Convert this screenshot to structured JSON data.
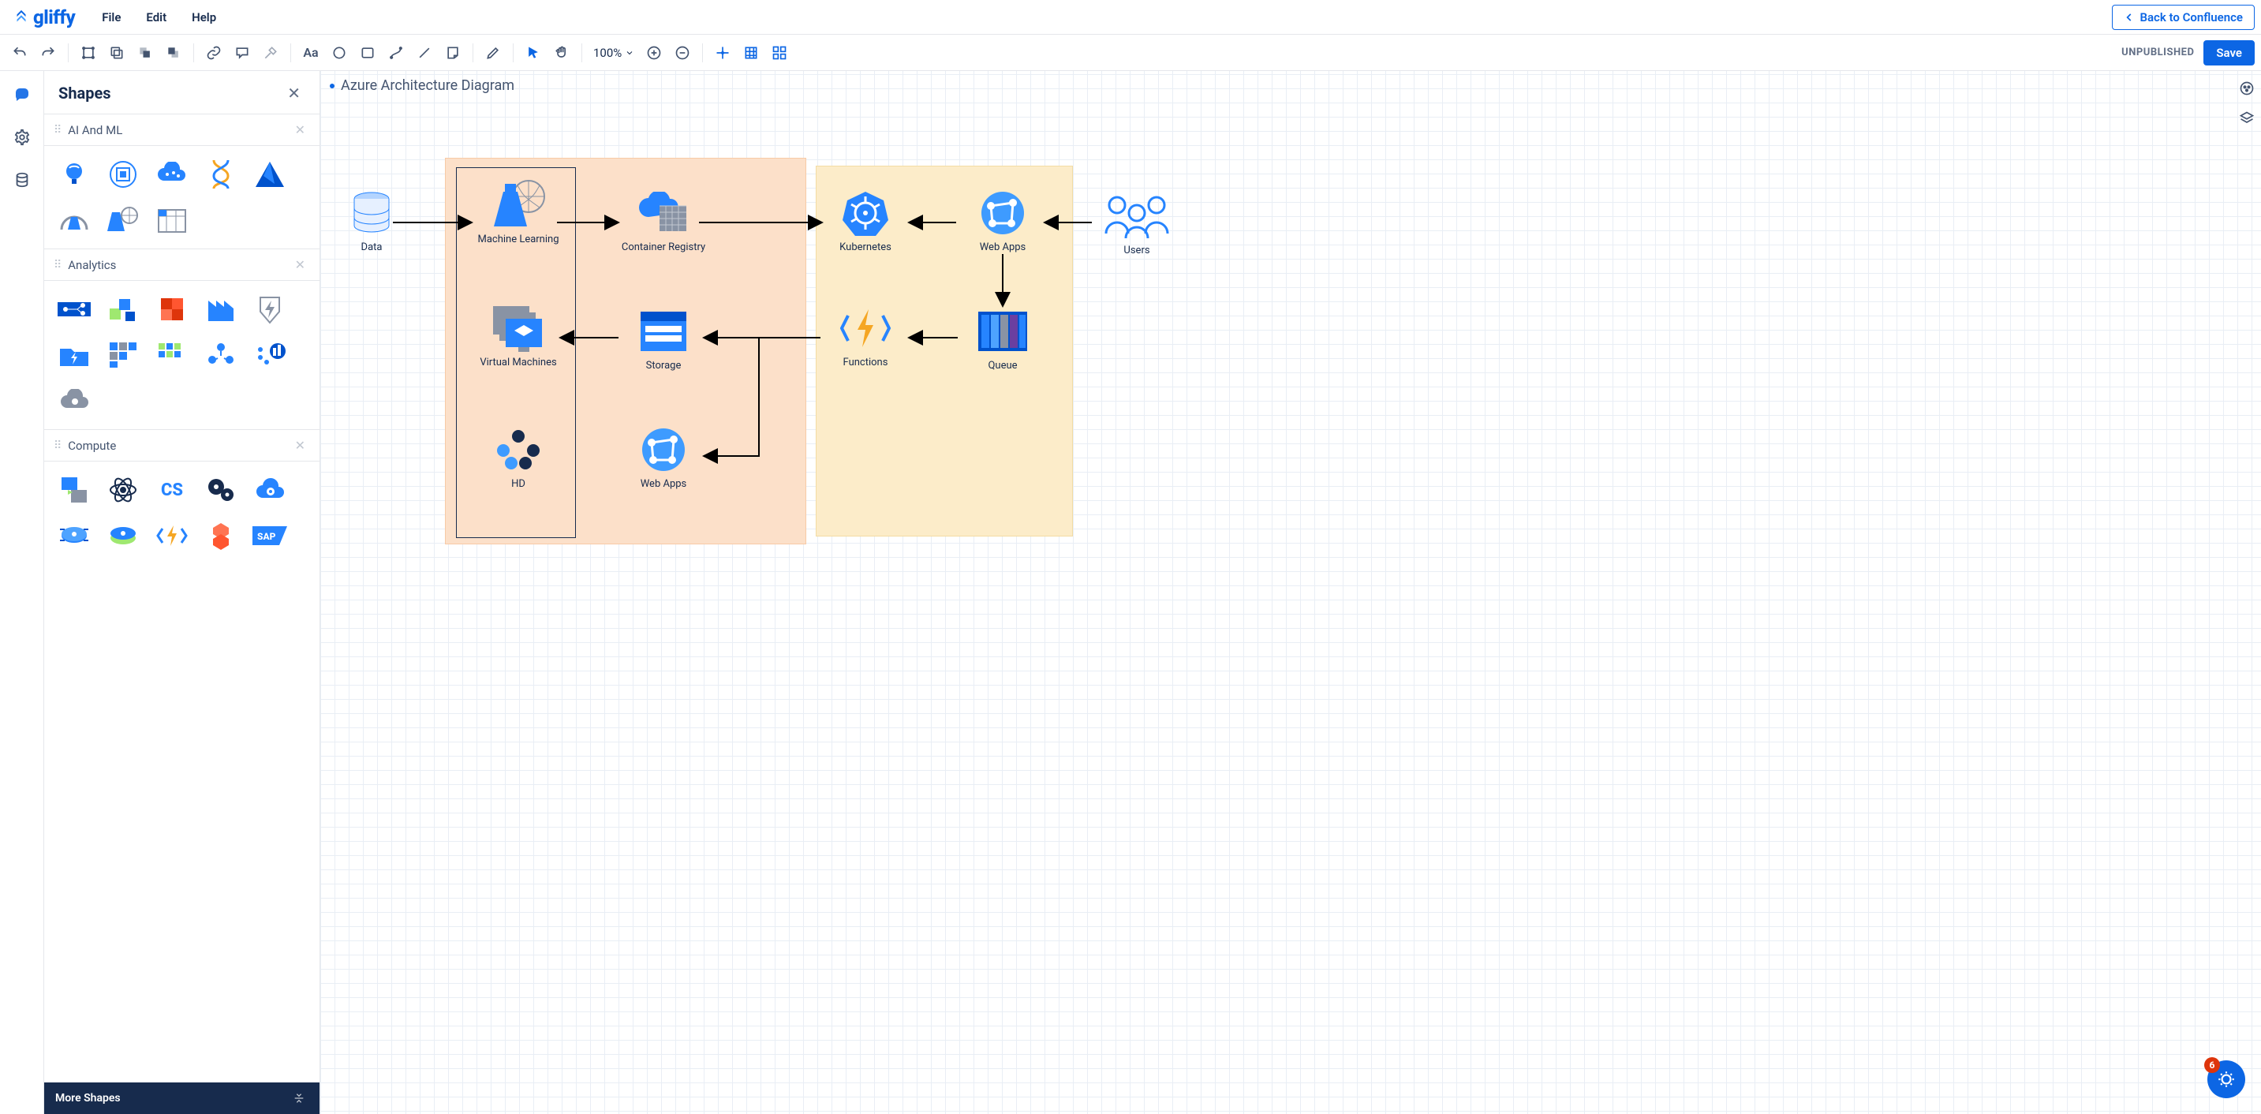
{
  "brand": "gliffy",
  "menus": [
    "File",
    "Edit",
    "Help"
  ],
  "back_label": "Back to Confluence",
  "status": "UNPUBLISHED",
  "save_label": "Save",
  "zoom": "100%",
  "panel": {
    "title": "Shapes",
    "more": "More Shapes",
    "categories": [
      {
        "name": "AI And ML",
        "shapes": [
          "brain-bulb",
          "chip",
          "cloud-brain",
          "dna",
          "azure-triangle",
          "gauge-flask",
          "flask-globe",
          "calendar-grid"
        ]
      },
      {
        "name": "Analytics",
        "shapes": [
          "flow-nodes",
          "diag-squares",
          "red-cubes",
          "factory-bars",
          "shield-bolt",
          "folder-bolt",
          "mosaic-1",
          "mosaic-2",
          "hex-graph",
          "dots-bar",
          "gear-cloud"
        ]
      },
      {
        "name": "Compute",
        "shapes": [
          "doc-arrow",
          "atom",
          "cs-logo",
          "gear-dark",
          "gear-cloud2",
          "disk-target",
          "disks",
          "bolt-brackets",
          "hex-orange",
          "sap"
        ]
      }
    ]
  },
  "diagram": {
    "title": "Azure Architecture Diagram",
    "nodes": {
      "data": "Data",
      "ml": "Machine Learning",
      "cr": "Container Registry",
      "k8s": "Kubernetes",
      "webapps1": "Web Apps",
      "users": "Users",
      "vm": "Virtual Machines",
      "storage": "Storage",
      "functions": "Functions",
      "queue": "Queue",
      "hd": "HD",
      "webapps2": "Web Apps"
    }
  },
  "fab_badge": "6"
}
